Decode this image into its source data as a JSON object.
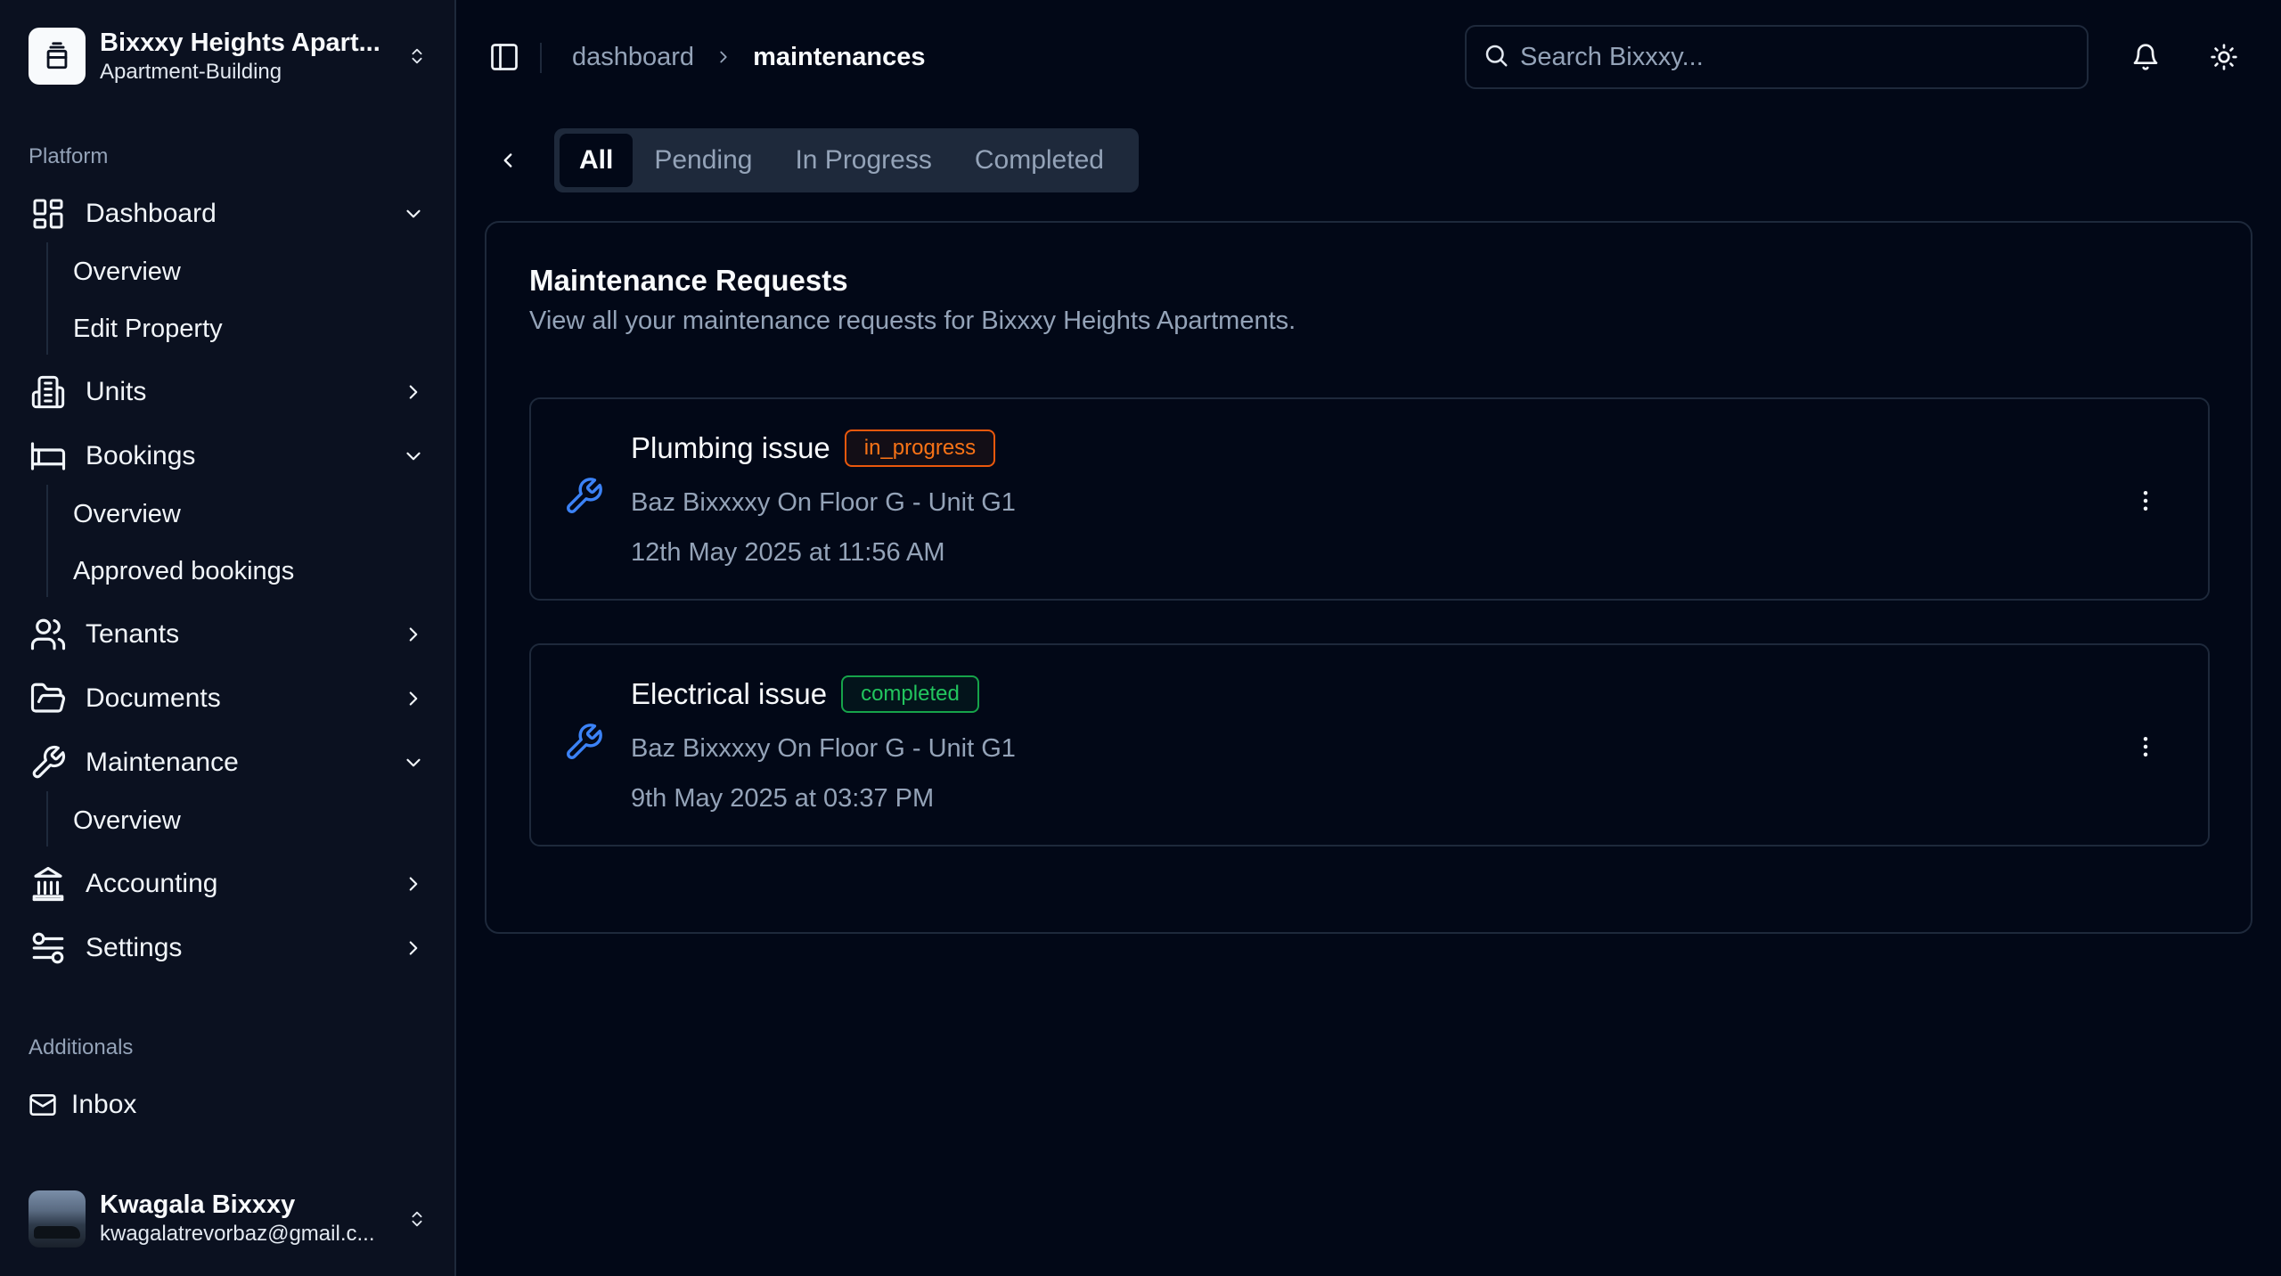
{
  "org": {
    "name": "Bixxxy Heights Apart...",
    "type": "Apartment-Building"
  },
  "sidebar": {
    "platform_label": "Platform",
    "additionals_label": "Additionals",
    "items": {
      "dashboard": "Dashboard",
      "dashboard_overview": "Overview",
      "dashboard_edit": "Edit Property",
      "units": "Units",
      "bookings": "Bookings",
      "bookings_overview": "Overview",
      "bookings_approved": "Approved bookings",
      "tenants": "Tenants",
      "documents": "Documents",
      "maintenance": "Maintenance",
      "maintenance_overview": "Overview",
      "accounting": "Accounting",
      "settings": "Settings",
      "inbox": "Inbox"
    }
  },
  "user": {
    "name": "Kwagala Bixxxy",
    "email": "kwagalatrevorbaz@gmail.c..."
  },
  "header": {
    "breadcrumb": [
      "dashboard",
      "maintenances"
    ],
    "search_placeholder": "Search Bixxxy..."
  },
  "tabs": [
    "All",
    "Pending",
    "In Progress",
    "Completed"
  ],
  "card": {
    "title": "Maintenance Requests",
    "description": "View all your maintenance requests for Bixxxy Heights Apartments."
  },
  "requests": [
    {
      "title": "Plumbing issue",
      "status": "in_progress",
      "location": "Baz Bixxxxy On Floor G - Unit G1",
      "date": "12th May 2025 at 11:56 AM"
    },
    {
      "title": "Electrical issue",
      "status": "completed",
      "location": "Baz Bixxxxy On Floor G - Unit G1",
      "date": "9th May 2025 at 03:37 PM"
    }
  ],
  "colors": {
    "background": "#020817",
    "sidebar": "#0b1120",
    "border": "#1e293b",
    "in_progress": "#f97316",
    "completed": "#22c55e",
    "wrench_icon": "#3b82f6"
  },
  "icons": {
    "org": "building-icon",
    "search": "search-icon",
    "notifications": "bell-icon",
    "theme": "sun-icon",
    "request": "wrench-icon",
    "actions": "more-vertical-icon"
  }
}
